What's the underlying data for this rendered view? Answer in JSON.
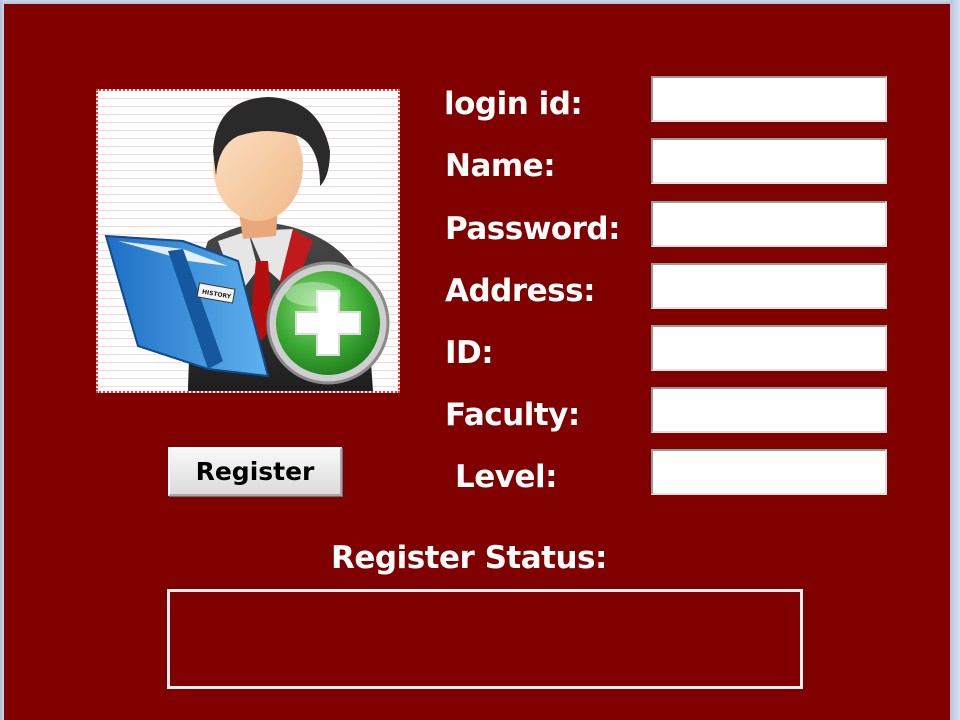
{
  "form": {
    "fields": [
      {
        "label": "login id:",
        "value": ""
      },
      {
        "label": "Name:",
        "value": ""
      },
      {
        "label": "Password:",
        "value": ""
      },
      {
        "label": "Address:",
        "value": ""
      },
      {
        "label": "ID:",
        "value": ""
      },
      {
        "label": "Faculty:",
        "value": ""
      },
      {
        "label": "Level:",
        "value": ""
      }
    ],
    "register_label": "Register"
  },
  "status": {
    "title": "Register Status:",
    "text": ""
  },
  "image": {
    "icon": "add-user-reader-icon",
    "book_label": "HISTORY"
  },
  "colors": {
    "panel_background": "#800000",
    "label_text": "#FFFFFF",
    "plus_badge": "#3aa832"
  }
}
